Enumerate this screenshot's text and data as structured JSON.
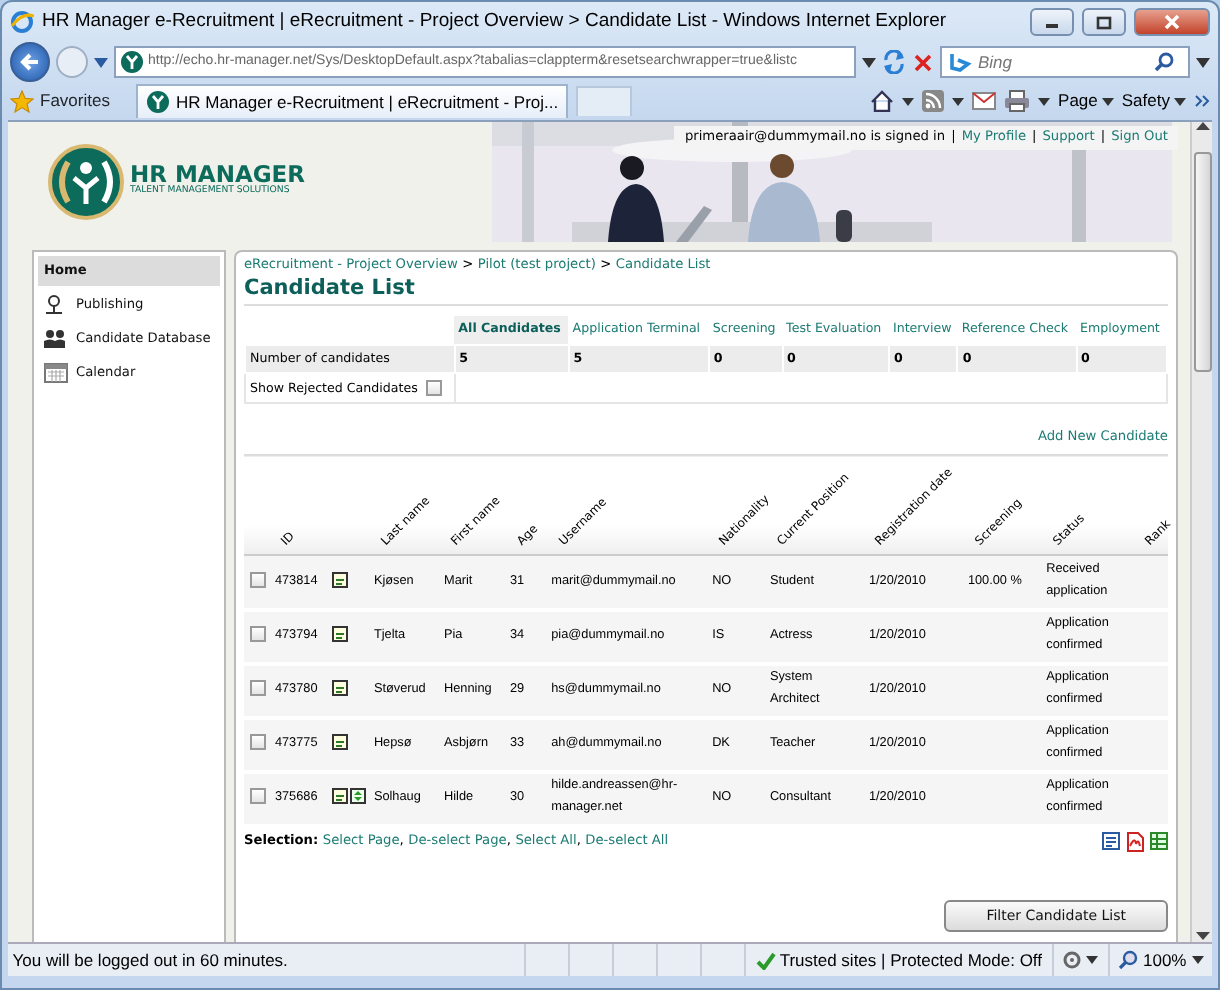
{
  "window": {
    "title": "HR Manager e-Recruitment | eRecruitment - Project Overview > Candidate List - Windows Internet Explorer"
  },
  "address": {
    "url": "http://echo.hr-manager.net/Sys/DesktopDefault.aspx?tabalias=clappterm&resetsearchwrapper=true&listc"
  },
  "search": {
    "placeholder": "Bing"
  },
  "favorites": "Favorites",
  "tab": {
    "title": "HR Manager e-Recruitment | eRecruitment - Proj..."
  },
  "commands": [
    "Page",
    "Safety"
  ],
  "header": {
    "logo_name": "HR MANAGER",
    "logo_tagline": "TALENT MANAGEMENT SOLUTIONS",
    "signed_in": "primeraair@dummymail.no is signed in",
    "separator": "|",
    "links": [
      "My Profile",
      "Support",
      "Sign Out"
    ]
  },
  "sidebar": {
    "items": [
      {
        "label": "Home",
        "selected": true,
        "kind": "none"
      },
      {
        "label": "Publishing",
        "selected": false,
        "kind": "publish"
      },
      {
        "label": "Candidate Database",
        "selected": false,
        "kind": "people"
      },
      {
        "label": "Calendar",
        "selected": false,
        "kind": "calendar"
      }
    ]
  },
  "breadcrumb": {
    "separator": ">",
    "items": [
      "eRecruitment - Project Overview",
      "Pilot (test project)",
      "Candidate List"
    ]
  },
  "page_title": "Candidate List",
  "pipeline": {
    "row_label": "Number of candidates",
    "stages": [
      {
        "label": "All Candidates",
        "selected": true,
        "count": "5"
      },
      {
        "label": "Application Terminal",
        "selected": false,
        "count": "5"
      },
      {
        "label": "Screening",
        "selected": false,
        "count": "0"
      },
      {
        "label": "Test Evaluation",
        "selected": false,
        "count": "0"
      },
      {
        "label": "Interview",
        "selected": false,
        "count": "0"
      },
      {
        "label": "Reference Check",
        "selected": false,
        "count": "0"
      },
      {
        "label": "Employment",
        "selected": false,
        "count": "0"
      }
    ],
    "show_rejected": {
      "label": "Show Rejected Candidates",
      "checked": false
    }
  },
  "add_link": "Add New Candidate",
  "table": {
    "columns": [
      "ID",
      "Last name",
      "First name",
      "Age",
      "Username",
      "Nationality",
      "Current Position",
      "Registration date",
      "Screening",
      "Status",
      "Rank"
    ],
    "rows": [
      {
        "checked": false,
        "extra_icon": false,
        "id": "473814",
        "last_name": "Kjøsen",
        "first_name": "Marit",
        "age": "31",
        "username": "marit@dummymail.no",
        "nationality": "NO",
        "position": "Student",
        "date": "1/20/2010",
        "screening": "100.00 %",
        "status": "Received application"
      },
      {
        "checked": false,
        "extra_icon": false,
        "id": "473794",
        "last_name": "Tjelta",
        "first_name": "Pia",
        "age": "34",
        "username": "pia@dummymail.no",
        "nationality": "IS",
        "position": "Actress",
        "date": "1/20/2010",
        "screening": "",
        "status": "Application confirmed"
      },
      {
        "checked": false,
        "extra_icon": false,
        "id": "473780",
        "last_name": "Støverud",
        "first_name": "Henning",
        "age": "29",
        "username": "hs@dummymail.no",
        "nationality": "NO",
        "position": "System Architect",
        "date": "1/20/2010",
        "screening": "",
        "status": "Application confirmed"
      },
      {
        "checked": false,
        "extra_icon": false,
        "id": "473775",
        "last_name": "Hepsø",
        "first_name": "Asbjørn",
        "age": "33",
        "username": "ah@dummymail.no",
        "nationality": "DK",
        "position": "Teacher",
        "date": "1/20/2010",
        "screening": "",
        "status": "Application confirmed"
      },
      {
        "checked": false,
        "extra_icon": true,
        "id": "375686",
        "last_name": "Solhaug",
        "first_name": "Hilde",
        "age": "30",
        "username": "hilde.andreassen@hr-manager.net",
        "nationality": "NO",
        "position": "Consultant",
        "date": "1/20/2010",
        "screening": "",
        "status": "Application confirmed"
      }
    ]
  },
  "selection": {
    "label": "Selection:",
    "separator": ",",
    "links": [
      "Select Page",
      "De-select Page",
      "Select All",
      "De-select All"
    ]
  },
  "filter_button": "Filter Candidate List",
  "status_bar": {
    "message": "You will be logged out in 60 minutes.",
    "zone": "Trusted sites | Protected Mode: Off",
    "zoom": "100%"
  }
}
